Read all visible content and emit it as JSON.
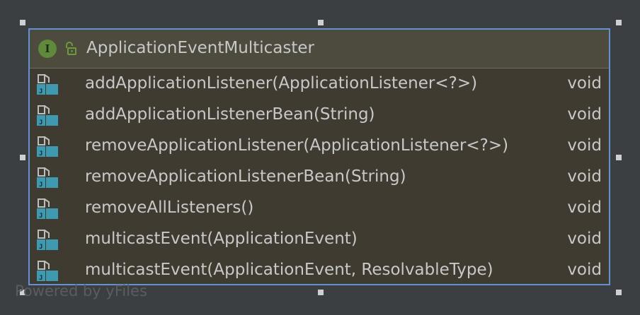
{
  "diagram": {
    "node": {
      "badge": "I",
      "title": "ApplicationEventMulticaster",
      "methods": [
        {
          "name": "addApplicationListener(ApplicationListener<?>)",
          "type": "void"
        },
        {
          "name": "addApplicationListenerBean(String)",
          "type": "void"
        },
        {
          "name": "removeApplicationListener(ApplicationListener<?>)",
          "type": "void"
        },
        {
          "name": "removeApplicationListenerBean(String)",
          "type": "void"
        },
        {
          "name": "removeAllListeners()",
          "type": "void"
        },
        {
          "name": "multicastEvent(ApplicationEvent)",
          "type": "void"
        },
        {
          "name": "multicastEvent(ApplicationEvent, ResolvableType)",
          "type": "void"
        }
      ]
    },
    "watermark": "Powered by yFiles"
  },
  "icons": {
    "header": [
      "interface-icon",
      "public-lock-icon"
    ],
    "method": "abstract-method-icon"
  },
  "colors": {
    "background": "#3c3f41",
    "node_fill": "#3f3b30",
    "header_fill": "#4d4a3e",
    "selection_border": "#5f93d6",
    "text": "#c8c8c8",
    "interface_badge": "#5f8a3a",
    "lock": "#6a9c3a",
    "method_icon": "#3d9ab0"
  }
}
